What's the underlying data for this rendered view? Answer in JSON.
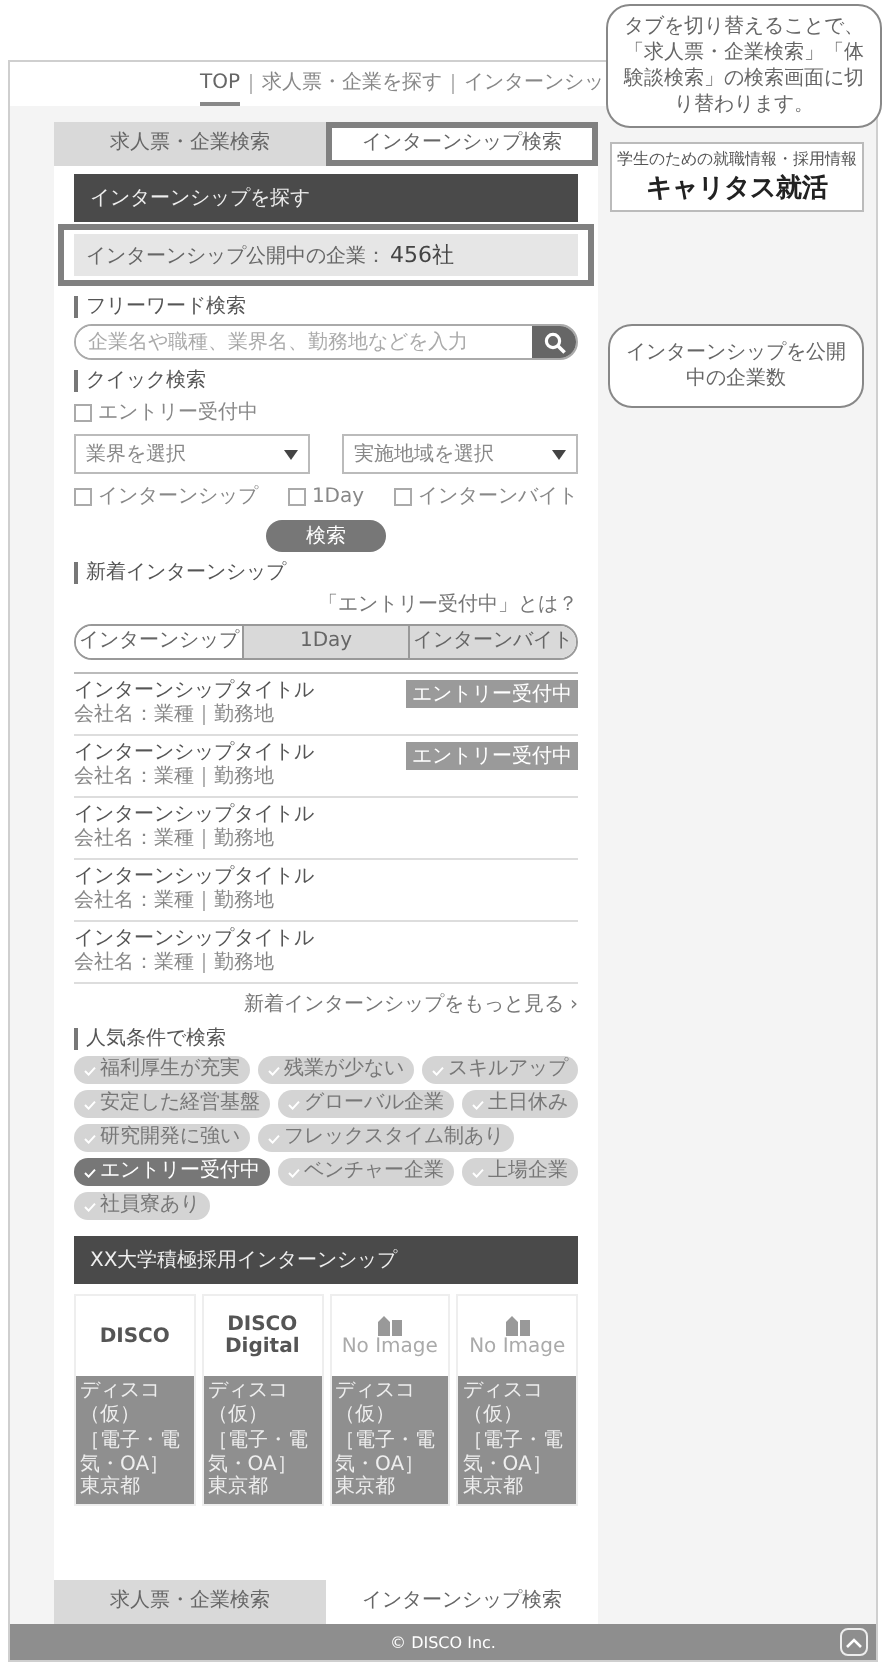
{
  "nav": {
    "items": [
      {
        "label": "TOP",
        "selected": true
      },
      {
        "label": "求人票・企業を探す",
        "selected": false
      },
      {
        "label": "インターンシッ",
        "selected": false
      }
    ]
  },
  "search_tabs": [
    {
      "label": "求人票・企業検索",
      "selected": false,
      "annotated": false
    },
    {
      "label": "インターンシップ検索",
      "selected": true,
      "annotated": true
    }
  ],
  "logo": {
    "tagline": "学生のための就職情報・採用情報",
    "name": "キャリタス就活"
  },
  "search_panel": {
    "title": "インターンシップを探す",
    "count": {
      "label": "インターンシップ公開中の企業：",
      "value": "456社",
      "annotated": true
    },
    "freeword": {
      "heading": "フリーワード検索",
      "placeholder": "企業名や職種、業界名、勤務地などを入力"
    },
    "quick": {
      "heading": "クイック検索",
      "entry_checkbox": {
        "label": "エントリー受付中",
        "checked": false
      },
      "selects": [
        "業界を選択",
        "実施地域を選択"
      ],
      "checkboxes": [
        {
          "label": "インターンシップ",
          "checked": false
        },
        {
          "label": "1Day",
          "checked": false
        },
        {
          "label": "インターンバイト",
          "checked": false
        }
      ],
      "button": "検索"
    }
  },
  "new_internships": {
    "heading": "新着インターンシップ",
    "help_link": "「エントリー受付中」とは？",
    "tabs": [
      {
        "label": "インターンシップ",
        "selected": true
      },
      {
        "label": "1Day",
        "selected": false
      },
      {
        "label": "インターンバイト",
        "selected": false
      }
    ],
    "items": [
      {
        "title": "インターンシップタイトル",
        "meta": "会社名：業種｜勤務地",
        "badge": "エントリー受付中"
      },
      {
        "title": "インターンシップタイトル",
        "meta": "会社名：業種｜勤務地",
        "badge": "エントリー受付中"
      },
      {
        "title": "インターンシップタイトル",
        "meta": "会社名：業種｜勤務地"
      },
      {
        "title": "インターンシップタイトル",
        "meta": "会社名：業種｜勤務地"
      },
      {
        "title": "インターンシップタイトル",
        "meta": "会社名：業種｜勤務地"
      }
    ],
    "more_link": "新着インターンシップをもっと見る ›"
  },
  "popular": {
    "heading": "人気条件で検索",
    "tags": [
      {
        "label": "福利厚生が充実",
        "selected": false
      },
      {
        "label": "残業が少ない",
        "selected": false
      },
      {
        "label": "スキルアップ",
        "selected": false
      },
      {
        "label": "安定した経営基盤",
        "selected": false
      },
      {
        "label": "グローバル企業",
        "selected": false
      },
      {
        "label": "土日休み",
        "selected": false
      },
      {
        "label": "研究開発に強い",
        "selected": false
      },
      {
        "label": "フレックスタイム制あり",
        "selected": false
      },
      {
        "label": "エントリー受付中",
        "selected": true
      },
      {
        "label": "ベンチャー企業",
        "selected": false
      },
      {
        "label": "上場企業",
        "selected": false
      },
      {
        "label": "社員寮あり",
        "selected": false
      }
    ]
  },
  "featured": {
    "title": "XX大学積極採用インターンシップ",
    "cards": [
      {
        "kind": "logo",
        "image_text": "DISCO",
        "company": "ディスコ（仮）",
        "industry": "［電子・電気・OA］",
        "location": "東京都"
      },
      {
        "kind": "logo",
        "image_text": "DISCO\nDigital",
        "company": "ディスコ（仮）",
        "industry": "［電子・電気・OA］",
        "location": "東京都"
      },
      {
        "kind": "noimage",
        "image_text": "No Image",
        "company": "ディスコ（仮）",
        "industry": "［電子・電気・OA］",
        "location": "東京都"
      },
      {
        "kind": "noimage",
        "image_text": "No Image",
        "company": "ディスコ（仮）",
        "industry": "［電子・電気・OA］",
        "location": "東京都"
      }
    ]
  },
  "bottom_tabs": [
    {
      "label": "求人票・企業検索",
      "selected": false
    },
    {
      "label": "インターンシップ検索",
      "selected": true
    }
  ],
  "footer": {
    "copyright": "© DISCO Inc."
  },
  "callouts": [
    {
      "text": "タブを切り替えることで、「求人票・企業検索」「体験談検索」の検索画面に切り替わります。"
    },
    {
      "text": "インターンシップを公開中の企業数"
    }
  ]
}
